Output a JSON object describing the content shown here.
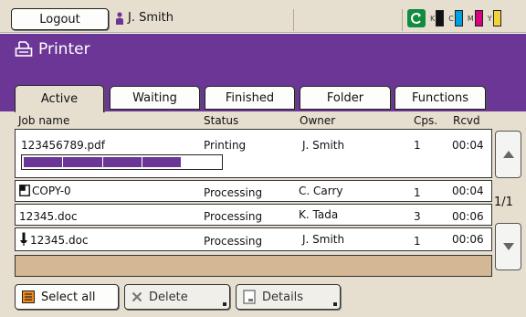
{
  "topbar": {
    "logout_label": "Logout",
    "user_name": "J. Smith",
    "toner": [
      {
        "label": "K",
        "color": "#111111"
      },
      {
        "label": "C",
        "color": "#00a0e0"
      },
      {
        "label": "M",
        "color": "#d7007d"
      },
      {
        "label": "Y",
        "color": "#f2d23a"
      }
    ]
  },
  "header": {
    "title": "Printer"
  },
  "tabs": [
    {
      "label": "Active",
      "active": true
    },
    {
      "label": "Waiting",
      "active": false
    },
    {
      "label": "Finished",
      "active": false
    },
    {
      "label": "Folder",
      "active": false
    },
    {
      "label": "Functions",
      "active": false
    }
  ],
  "columns": {
    "job_name": "Job name",
    "status": "Status",
    "owner": "Owner",
    "copies": "Cps.",
    "received": "Rcvd"
  },
  "jobs": [
    {
      "name": "123456789.pdf",
      "status": "Printing",
      "owner": "J. Smith",
      "copies": "1",
      "received": "00:04",
      "icon": "none",
      "progress": 0.8
    },
    {
      "name": "COPY-0",
      "status": "Processing",
      "owner": "C. Carry",
      "copies": "1",
      "received": "00:04",
      "icon": "copy-icon"
    },
    {
      "name": "12345.doc",
      "status": "Processing",
      "owner": "K. Tada",
      "copies": "3",
      "received": "00:06",
      "icon": "none"
    },
    {
      "name": "12345.doc",
      "status": "Processing",
      "owner": "J. Smith",
      "copies": "1",
      "received": "00:06",
      "icon": "pin-icon"
    }
  ],
  "pagination": {
    "page": "1/1"
  },
  "footer": {
    "select_all_label": "Select all",
    "delete_label": "Delete",
    "details_label": "Details"
  },
  "colors": {
    "accent": "#6c3696",
    "panel": "#e6dfcf",
    "status_ok": "#118b3e",
    "empty_row": "#d4b794"
  }
}
